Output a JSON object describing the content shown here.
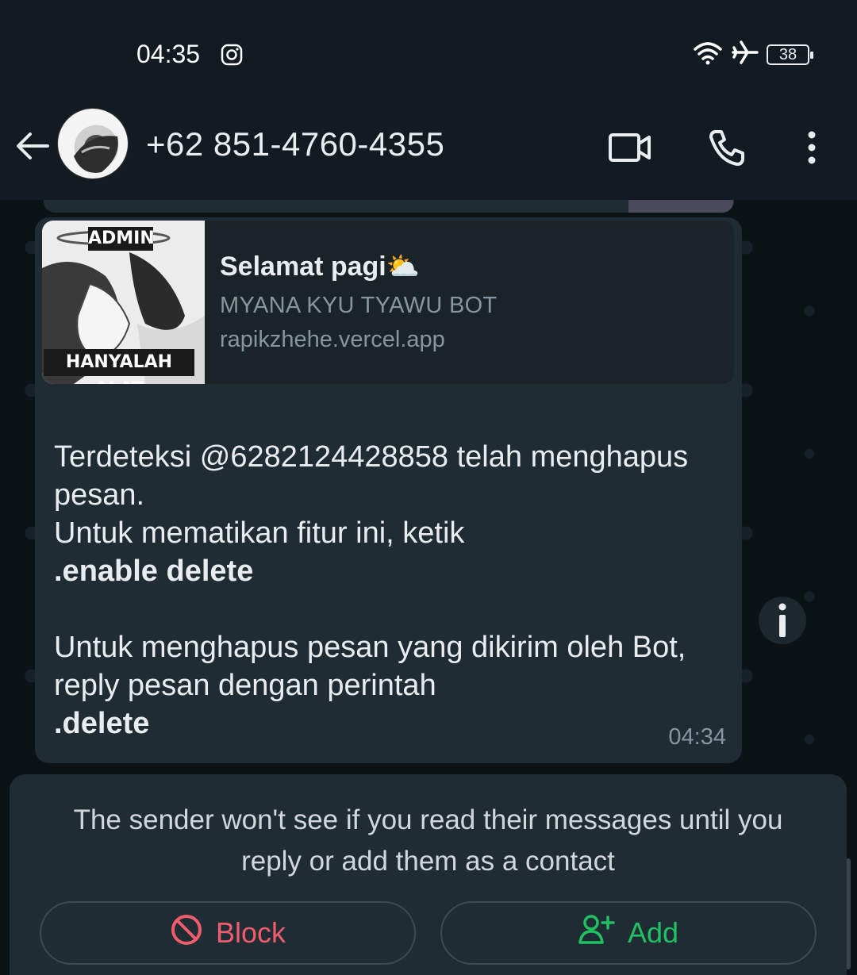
{
  "status_bar": {
    "time": "04:35",
    "battery": "38"
  },
  "header": {
    "contact": "+62 851-4760-4355"
  },
  "link_preview": {
    "title": "Selamat pagi⛅",
    "subtitle": "MYANA KYU TYAWU BOT",
    "url": "rapikzhehe.vercel.app",
    "thumb_top_label": "ADMIN",
    "thumb_bottom_label": "HANYALAH ALAT"
  },
  "message": {
    "line1": "Terdeteksi @6282124428858 telah menghapus pesan.",
    "line2": "Untuk mematikan fitur ini, ketik",
    "cmd1": ".enable delete",
    "line3": "Untuk menghapus pesan yang dikirim oleh Bot, reply pesan dengan perintah",
    "cmd2": ".delete",
    "time": "04:34"
  },
  "privacy_panel": {
    "text": "The sender won't see if you read their messages until you reply or add them as a contact",
    "block_label": "Block",
    "add_label": "Add"
  },
  "colors": {
    "block": "#f15c6d",
    "add": "#21c063",
    "bubble": "#202c33",
    "header": "#111b21"
  }
}
